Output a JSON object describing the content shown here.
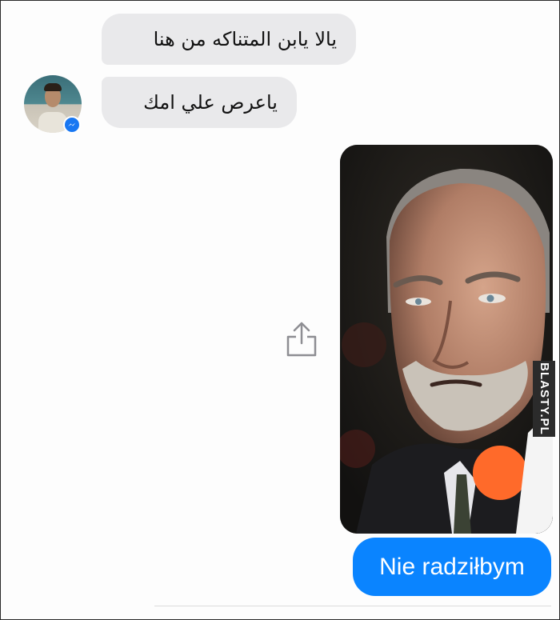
{
  "conversation": {
    "incoming": [
      {
        "text": "يالا يابن المتناكه من هنا"
      },
      {
        "text": "ياعرص علي امك"
      }
    ],
    "outgoing": [
      {
        "text": "Nie radziłbym"
      }
    ]
  },
  "icons": {
    "avatar_badge": "messenger-icon",
    "share": "share-icon"
  },
  "colors": {
    "incoming_bubble": "#e9e9eb",
    "outgoing_bubble": "#0a84ff",
    "messenger_blue": "#1877f2"
  },
  "watermark": {
    "text": "BLASTY.PL"
  }
}
